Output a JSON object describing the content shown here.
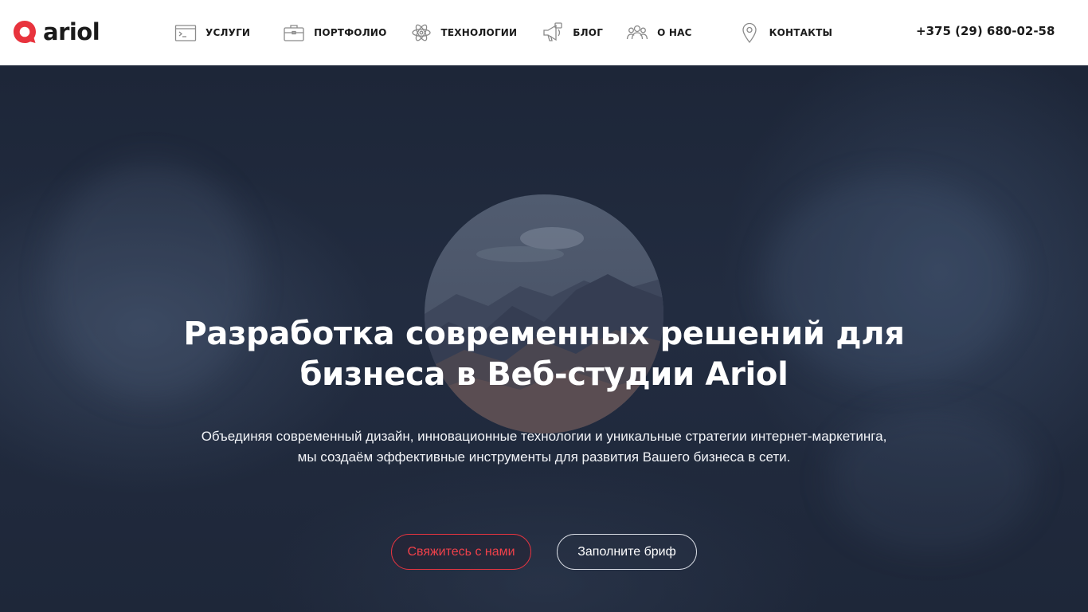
{
  "header": {
    "logo_text": "ariol",
    "brand_color": "#e8333d",
    "nav": [
      {
        "label": "УСЛУГИ",
        "icon": "terminal-window-icon"
      },
      {
        "label": "ПОРТФОЛИО",
        "icon": "briefcase-icon"
      },
      {
        "label": "ТЕХНОЛОГИИ",
        "icon": "atom-icon"
      },
      {
        "label": "БЛОГ",
        "icon": "megaphone-icon"
      },
      {
        "label": "О НАС",
        "icon": "team-icon"
      },
      {
        "label": "КОНТАКТЫ",
        "icon": "map-pin-icon"
      }
    ],
    "phone": "+375 (29) 680-02-58"
  },
  "hero": {
    "title_line1": "Разработка современных решений для",
    "title_line2": "бизнеса в Веб-студии Ariol",
    "subtitle_line1": "Объединяя современный дизайн, инновационные технологии и уникальные стратегии интернет-маркетинга,",
    "subtitle_line2": "мы создаём эффективные инструменты для развития Вашего бизнеса в сети.",
    "cta_primary": "Свяжитесь с нами",
    "cta_secondary": "Заполните бриф",
    "image": "mountain-landscape-circle"
  }
}
